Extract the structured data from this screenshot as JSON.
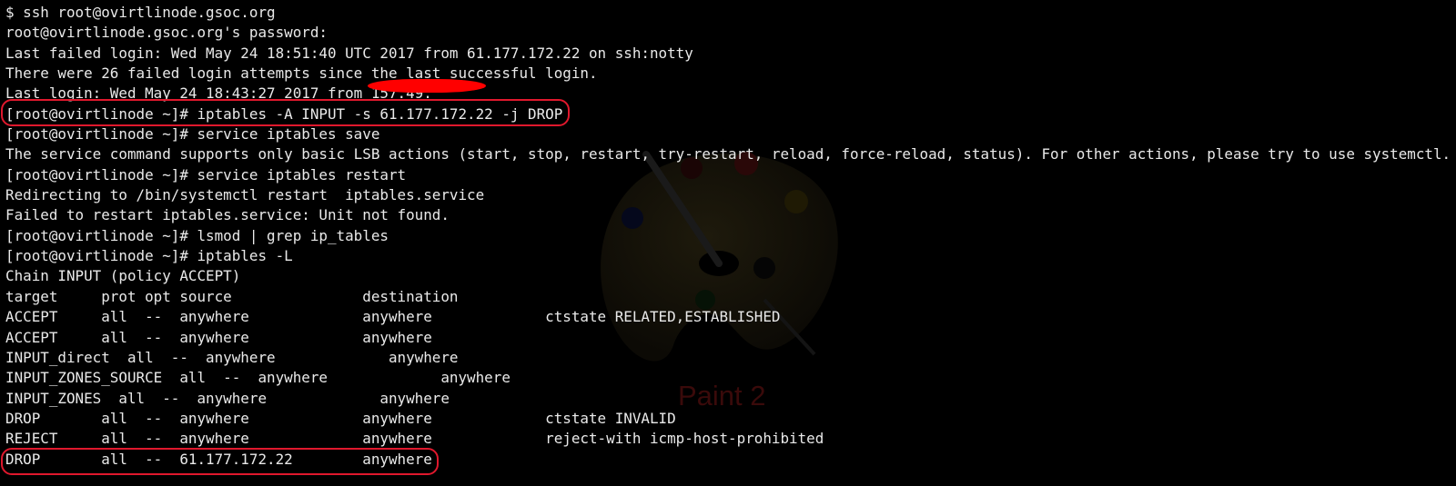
{
  "watermark": {
    "label": "Paint 2",
    "icon": "palette-icon"
  },
  "terminal": {
    "lines": [
      "$ ssh root@ovirtlinode.gsoc.org",
      "root@ovirtlinode.gsoc.org's password:",
      "Last failed login: Wed May 24 18:51:40 UTC 2017 from 61.177.172.22 on ssh:notty",
      "There were 26 failed login attempts since the last successful login.",
      "Last login: Wed May 24 18:43:27 2017 from 157.49.     ",
      "[root@ovirtlinode ~]# iptables -A INPUT -s 61.177.172.22 -j DROP",
      "[root@ovirtlinode ~]# service iptables save",
      "The service command supports only basic LSB actions (start, stop, restart, try-restart, reload, force-reload, status). For other actions, please try to use systemctl.",
      "[root@ovirtlinode ~]# service iptables restart",
      "Redirecting to /bin/systemctl restart  iptables.service",
      "Failed to restart iptables.service: Unit not found.",
      "[root@ovirtlinode ~]# lsmod | grep ip_tables",
      "[root@ovirtlinode ~]# iptables -L",
      "Chain INPUT (policy ACCEPT)",
      "target     prot opt source               destination",
      "ACCEPT     all  --  anywhere             anywhere             ctstate RELATED,ESTABLISHED",
      "ACCEPT     all  --  anywhere             anywhere",
      "INPUT_direct  all  --  anywhere             anywhere",
      "INPUT_ZONES_SOURCE  all  --  anywhere             anywhere",
      "INPUT_ZONES  all  --  anywhere             anywhere",
      "DROP       all  --  anywhere             anywhere             ctstate INVALID",
      "REJECT     all  --  anywhere             anywhere             reject-with icmp-host-prohibited",
      "DROP       all  --  61.177.172.22        anywhere"
    ]
  },
  "colors": {
    "background": "#000000",
    "text": "#e9e9e9",
    "highlight": "#e0182d",
    "redaction": "#ff0000"
  }
}
